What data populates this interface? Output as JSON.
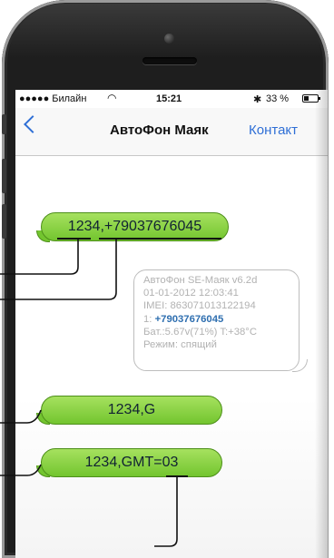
{
  "status_bar": {
    "carrier": "●●●●● Билайн",
    "time": "15:21",
    "battery": "33 %"
  },
  "nav": {
    "title": "АвтоФон Маяк",
    "contact": "Контакт"
  },
  "messages": {
    "out_1_code": "1234",
    "out_1_sep": ",",
    "out_1_phone": "+79037676045",
    "in_line_1": "АвтоФон SE-Маяк v6.2d",
    "in_line_2": "01-01-2012 12:03:41",
    "in_line_3": "IMEI: 863071013122194",
    "in_line_4_prefix": "1: ",
    "in_line_4_phone": "+79037676045",
    "in_line_5": "Бат.:5.67v(71%) T:+38°C",
    "in_line_6": "Режим: спящий",
    "out_2": "1234,G",
    "out_3_prefix": "1234,GMT=",
    "out_3_value": "03"
  },
  "colors": {
    "accent": "#2f6fd6",
    "bubble_green": "#73c52f",
    "phone_number_blue": "#2f6fb0"
  }
}
